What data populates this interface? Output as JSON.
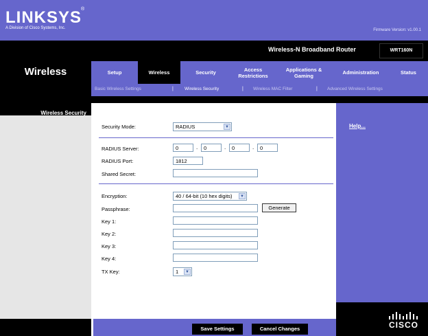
{
  "brand": {
    "logo": "LINKSYS",
    "registered": "®",
    "tagline": "A Division of Cisco Systems, Inc.",
    "firmware": "Firmware Version: v1.00.1"
  },
  "header": {
    "product": "Wireless-N Broadband Router",
    "model": "WRT160N"
  },
  "page": {
    "title": "Wireless",
    "section": "Wireless Security"
  },
  "tabs": [
    {
      "label": "Setup"
    },
    {
      "label": "Wireless"
    },
    {
      "label": "Security"
    },
    {
      "label": "Access\nRestrictions"
    },
    {
      "label": "Applications &\nGaming"
    },
    {
      "label": "Administration"
    },
    {
      "label": "Status"
    }
  ],
  "subtabs": [
    {
      "label": "Basic Wireless Settings"
    },
    {
      "label": "Wireless Security"
    },
    {
      "label": "Wireless MAC Filter"
    },
    {
      "label": "Advanced Wireless Settings"
    }
  ],
  "separator": "|",
  "form": {
    "security_mode_label": "Security Mode:",
    "security_mode_value": "RADIUS",
    "radius_server_label": "RADIUS Server:",
    "radius_ip": [
      "0",
      "0",
      "0",
      "0"
    ],
    "ip_dot": ".",
    "radius_port_label": "RADIUS Port:",
    "radius_port_value": "1812",
    "shared_secret_label": "Shared Secret:",
    "shared_secret_value": "",
    "encryption_label": "Encryption:",
    "encryption_value": "40 / 64-bit (10 hex digits)",
    "passphrase_label": "Passphrase:",
    "passphrase_value": "",
    "generate_label": "Generate",
    "key1_label": "Key 1:",
    "key2_label": "Key 2:",
    "key3_label": "Key 3:",
    "key4_label": "Key 4:",
    "tx_key_label": "TX Key:",
    "tx_key_value": "1",
    "dropdown_arrow": "▼"
  },
  "help": {
    "label": "Help..."
  },
  "footer": {
    "save_label": "Save Settings",
    "cancel_label": "Cancel Changes"
  },
  "cisco": {
    "text": "CISCO",
    "bars": "ıllıllı"
  },
  "colors": {
    "purple": "#6666cc",
    "black": "#000000",
    "panel_gray": "#e6e6e6"
  }
}
